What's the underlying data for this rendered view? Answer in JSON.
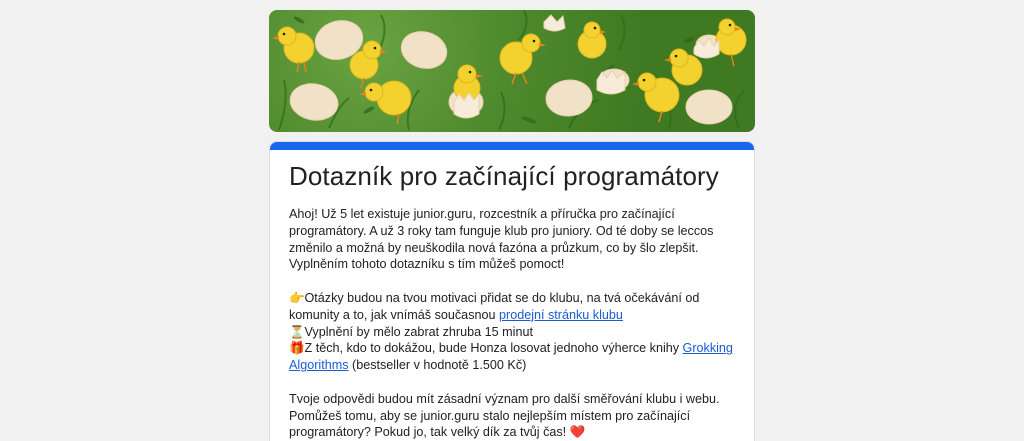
{
  "form": {
    "title": "Dotazník pro začínající programátory",
    "intro": "Ahoj! Už 5 let existuje junior.guru, rozcestník a příručka pro začínající programátory. A už 3 roky tam funguje klub pro juniory. Od té doby se leccos změnilo a možná by neuškodila nová fazóna a průzkum, co by šlo zlepšit. Vyplněním tohoto dotazníku s tím můžeš pomoct!",
    "bullet1_icon": "👉",
    "bullet1_text": " Otázky budou na tvou motivaci přidat se do klubu, na tvá očekávání od komunity a to, jak vnímáš současnou ",
    "bullet1_link": "prodejní stránku klubu",
    "bullet2_icon": "⏳",
    "bullet2_text": " Vyplnění by mělo zabrat zhruba 15 minut",
    "bullet3_icon": "🎁",
    "bullet3_text": " Z těch, kdo to dokážou, bude Honza losovat jednoho výherce knihy ",
    "bullet3_link": "Grokking Algorithms",
    "bullet3_after": " (bestseller v hodnotě 1.500 Kč)",
    "closing": "Tvoje odpovědi budou mít zásadní význam pro další směřování klubu i webu. Pomůžeš tomu, aby se junior.guru stalo nejlepším místem pro začínající programátory? Pokud jo, tak velký dík za tvůj čas! ",
    "heart": "❤️"
  },
  "colors": {
    "accent": "#1a66f0",
    "link": "#1a5bd6",
    "background": "#f1f1f1",
    "banner_green": "#4c8a2b"
  }
}
